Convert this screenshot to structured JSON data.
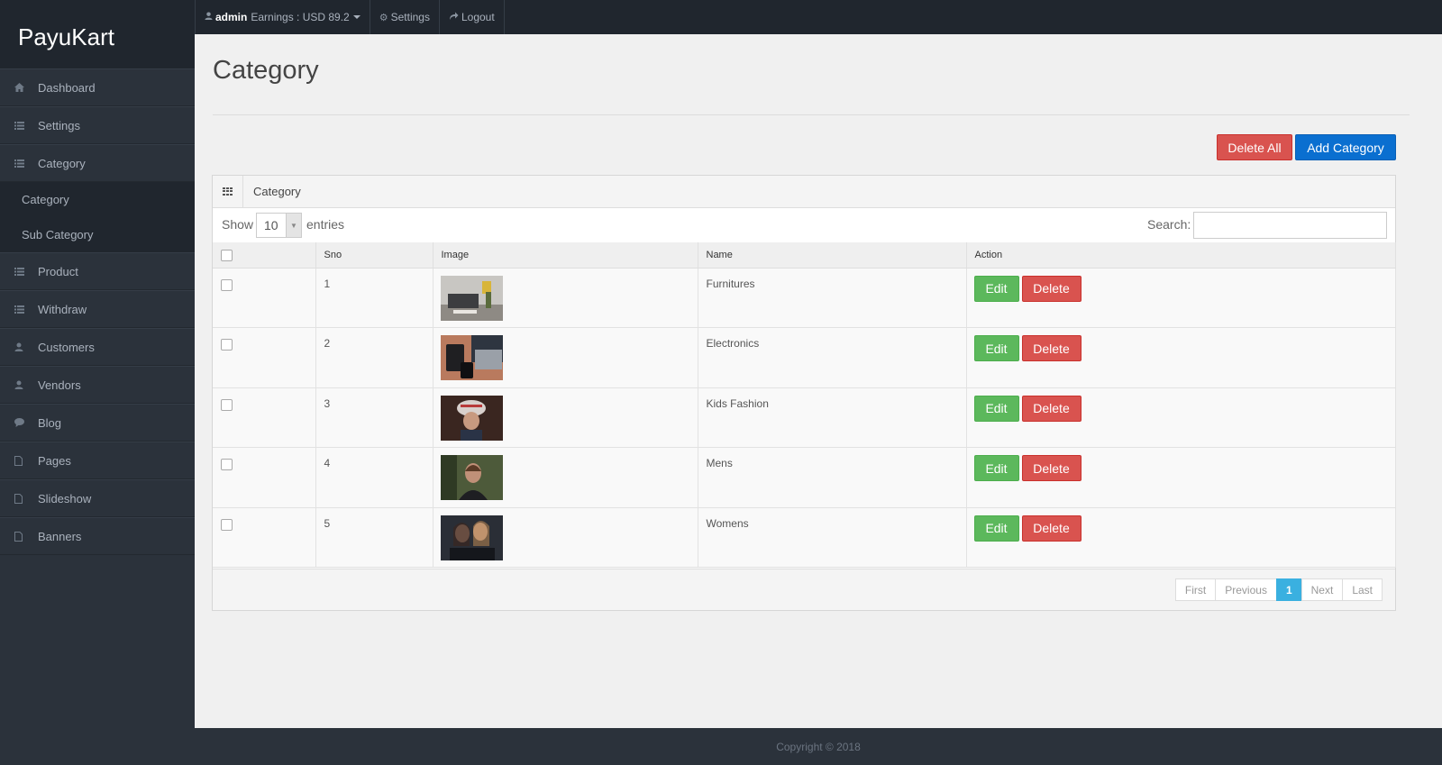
{
  "brand": "PayuKart",
  "topbar": {
    "user": "admin",
    "earnings": "Earnings : USD 89.2",
    "settings": "Settings",
    "logout": "Logout"
  },
  "sidebar": {
    "items": [
      {
        "label": "Dashboard",
        "icon": "home-icon"
      },
      {
        "label": "Settings",
        "icon": "list-icon"
      },
      {
        "label": "Category",
        "icon": "list-icon"
      },
      {
        "label": "Product",
        "icon": "list-icon"
      },
      {
        "label": "Withdraw",
        "icon": "list-icon"
      },
      {
        "label": "Customers",
        "icon": "user-icon"
      },
      {
        "label": "Vendors",
        "icon": "user-icon"
      },
      {
        "label": "Blog",
        "icon": "comment-icon"
      },
      {
        "label": "Pages",
        "icon": "file-icon"
      },
      {
        "label": "Slideshow",
        "icon": "file-icon"
      },
      {
        "label": "Banners",
        "icon": "file-icon"
      }
    ],
    "sub_items": [
      {
        "label": "Category"
      },
      {
        "label": "Sub Category"
      }
    ]
  },
  "main": {
    "title": "Category",
    "delete_all": "Delete All",
    "add_category": "Add Category",
    "panel_title": "Category",
    "show_label": "Show",
    "length_value": "10",
    "entries_label": "entries",
    "search_label": "Search:",
    "search_value": "",
    "columns": [
      "",
      "Sno",
      "Image",
      "Name",
      "Action"
    ],
    "rows": [
      {
        "sno": "1",
        "name": "Furnitures",
        "image": "furniture-photo"
      },
      {
        "sno": "2",
        "name": "Electronics",
        "image": "electronics-photo"
      },
      {
        "sno": "3",
        "name": "Kids Fashion",
        "image": "kids-photo"
      },
      {
        "sno": "4",
        "name": "Mens",
        "image": "mens-photo"
      },
      {
        "sno": "5",
        "name": "Womens",
        "image": "womens-photo"
      }
    ],
    "edit_label": "Edit",
    "delete_label": "Delete",
    "pager": {
      "first": "First",
      "previous": "Previous",
      "current": "1",
      "next": "Next",
      "last": "Last"
    }
  },
  "footer": "Copyright © 2018",
  "colors": {
    "sidebar_bg": "#2b323b",
    "brand_bg": "#20262e",
    "red": "#d9534f",
    "blue": "#0a6fd0",
    "green": "#5cb85c",
    "pager_active": "#3ab0e0"
  }
}
